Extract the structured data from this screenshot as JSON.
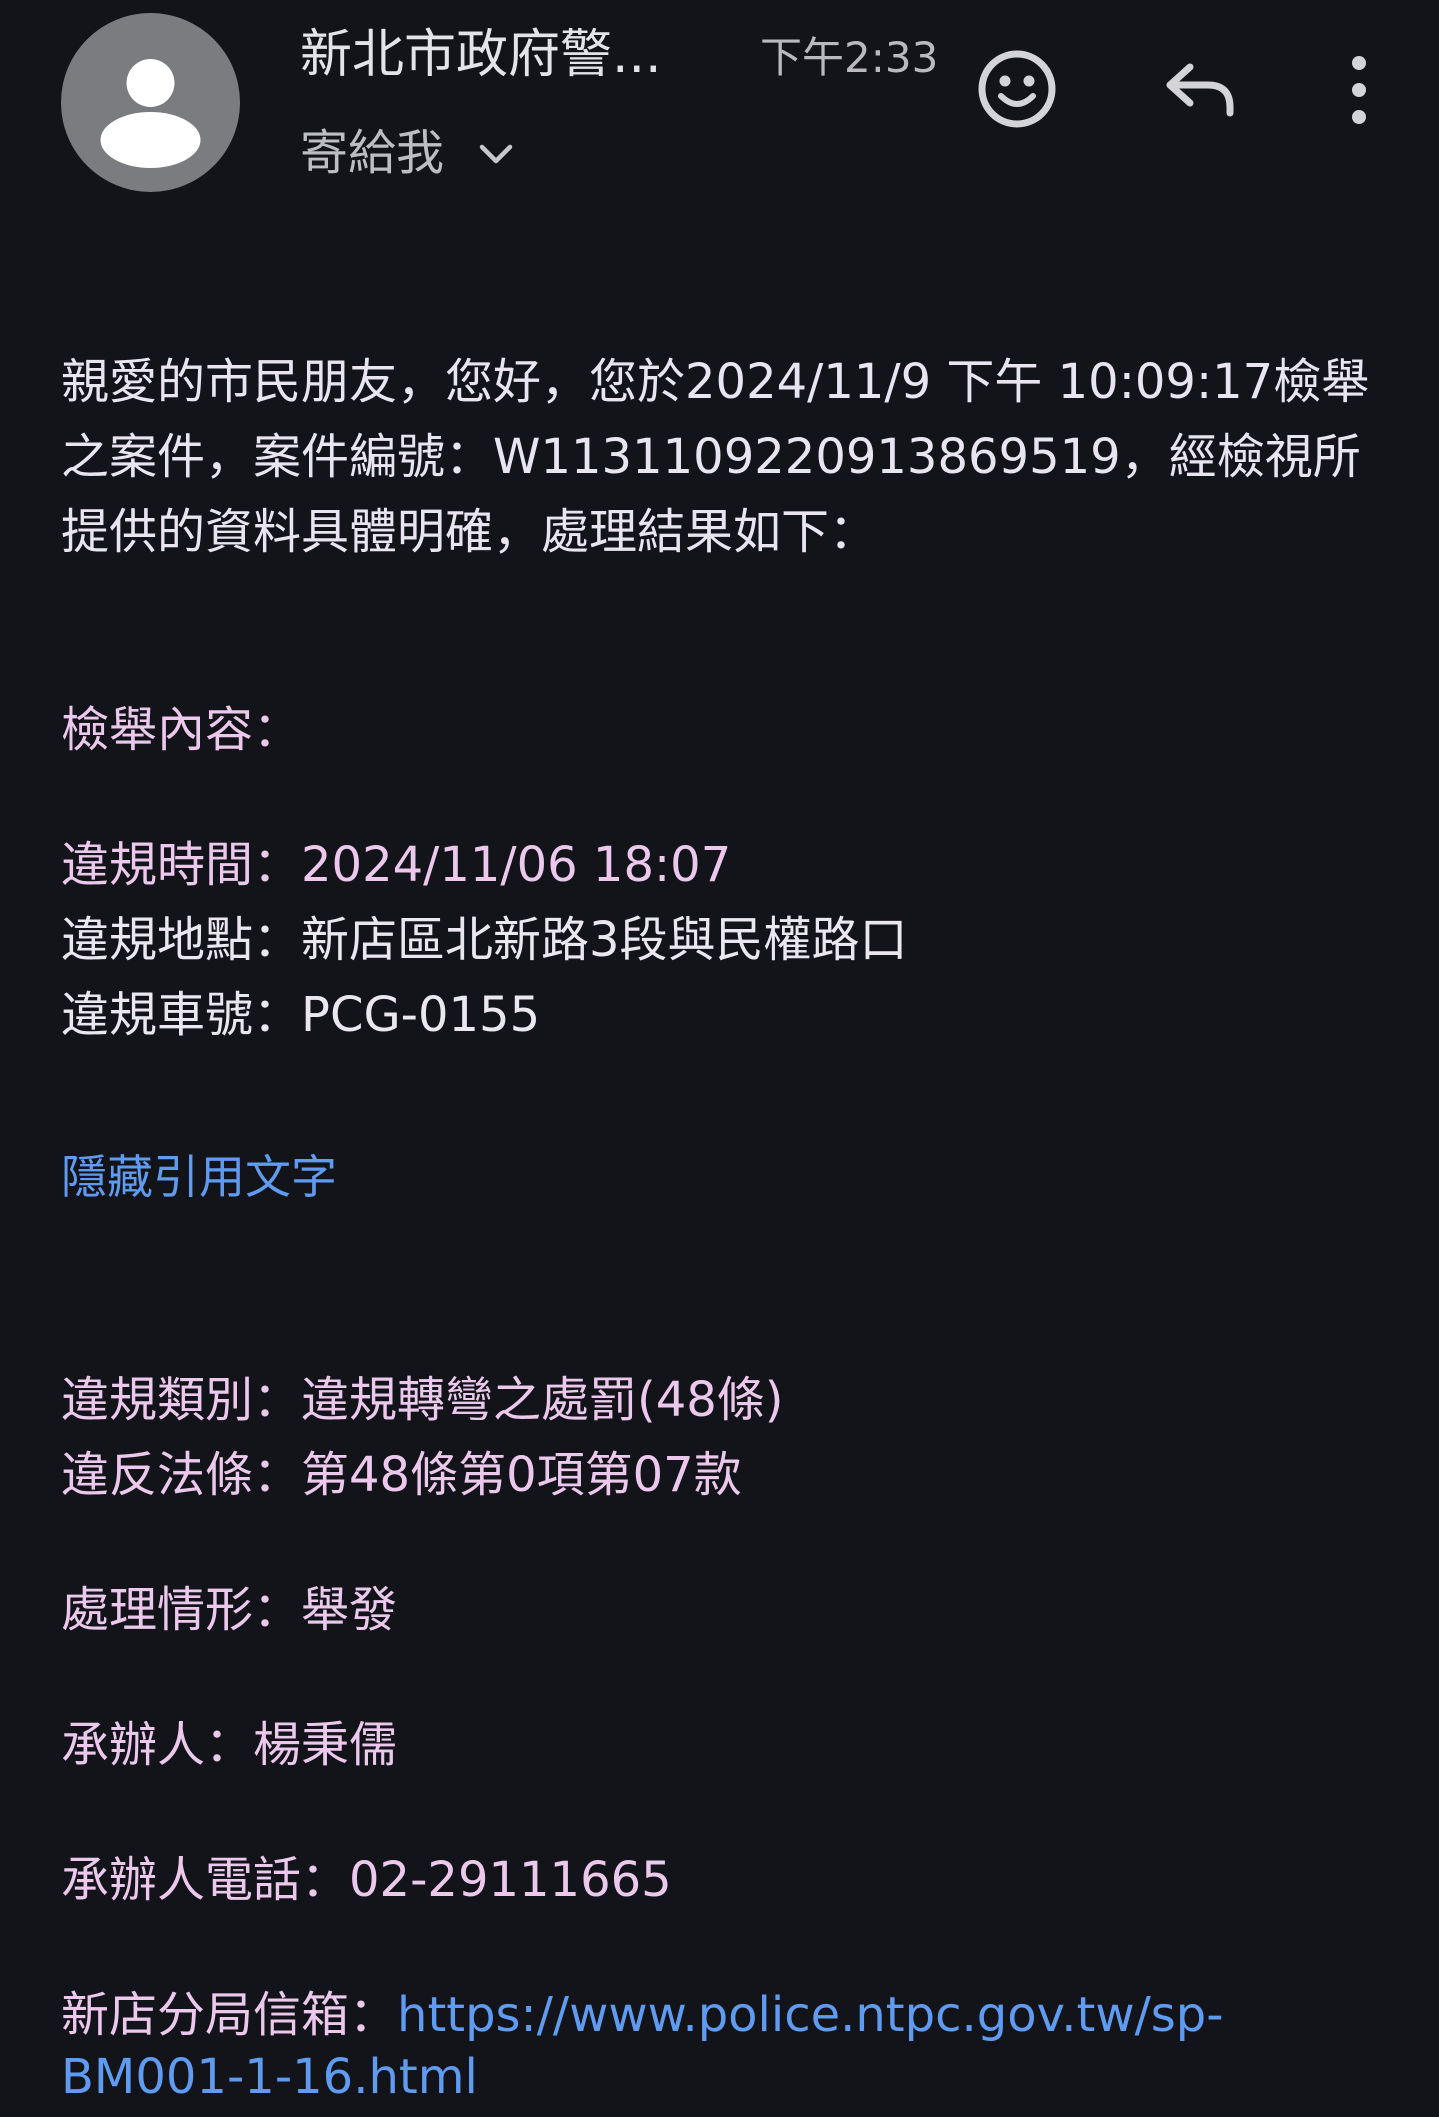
{
  "header": {
    "sender": "新北市政府警...",
    "time": "下午2:33",
    "recipient": "寄給我"
  },
  "icons": {
    "avatar": "person-icon",
    "emoji": "smiley-icon",
    "reply": "reply-icon",
    "more": "more-vert-icon",
    "expand": "chevron-down-icon"
  },
  "message": {
    "intro": "親愛的市民朋友，您好，您於2024/11/9 下午 10:09:17檢舉之案件，案件編號：W1131109220913869519，經檢視所提供的資料具體明確，處理結果如下：",
    "report_content_label": "檢舉內容：",
    "violation_time": "違規時間：2024/11/06 18:07",
    "violation_place": "違規地點：新店區北新路3段與民權路口",
    "plate_number": "違規車號：PCG-0155",
    "hide_quoted": "隱藏引用文字",
    "violation_type": "違規類別：違規轉彎之處罰(48條)",
    "law_article": "違反法條：第48條第0項第07款",
    "status": "處理情形：舉發",
    "handler": "承辦人：楊秉儒",
    "handler_phone": "承辦人電話：02-29111665",
    "mailbox_label": "新店分局信箱：",
    "mailbox_url": "https://www.police.ntpc.gov.tw/sp-BM001-1-16.html"
  },
  "colors": {
    "background": "#12141a",
    "link": "#5f9bf0",
    "quoted_text": "#ebc8ec"
  }
}
